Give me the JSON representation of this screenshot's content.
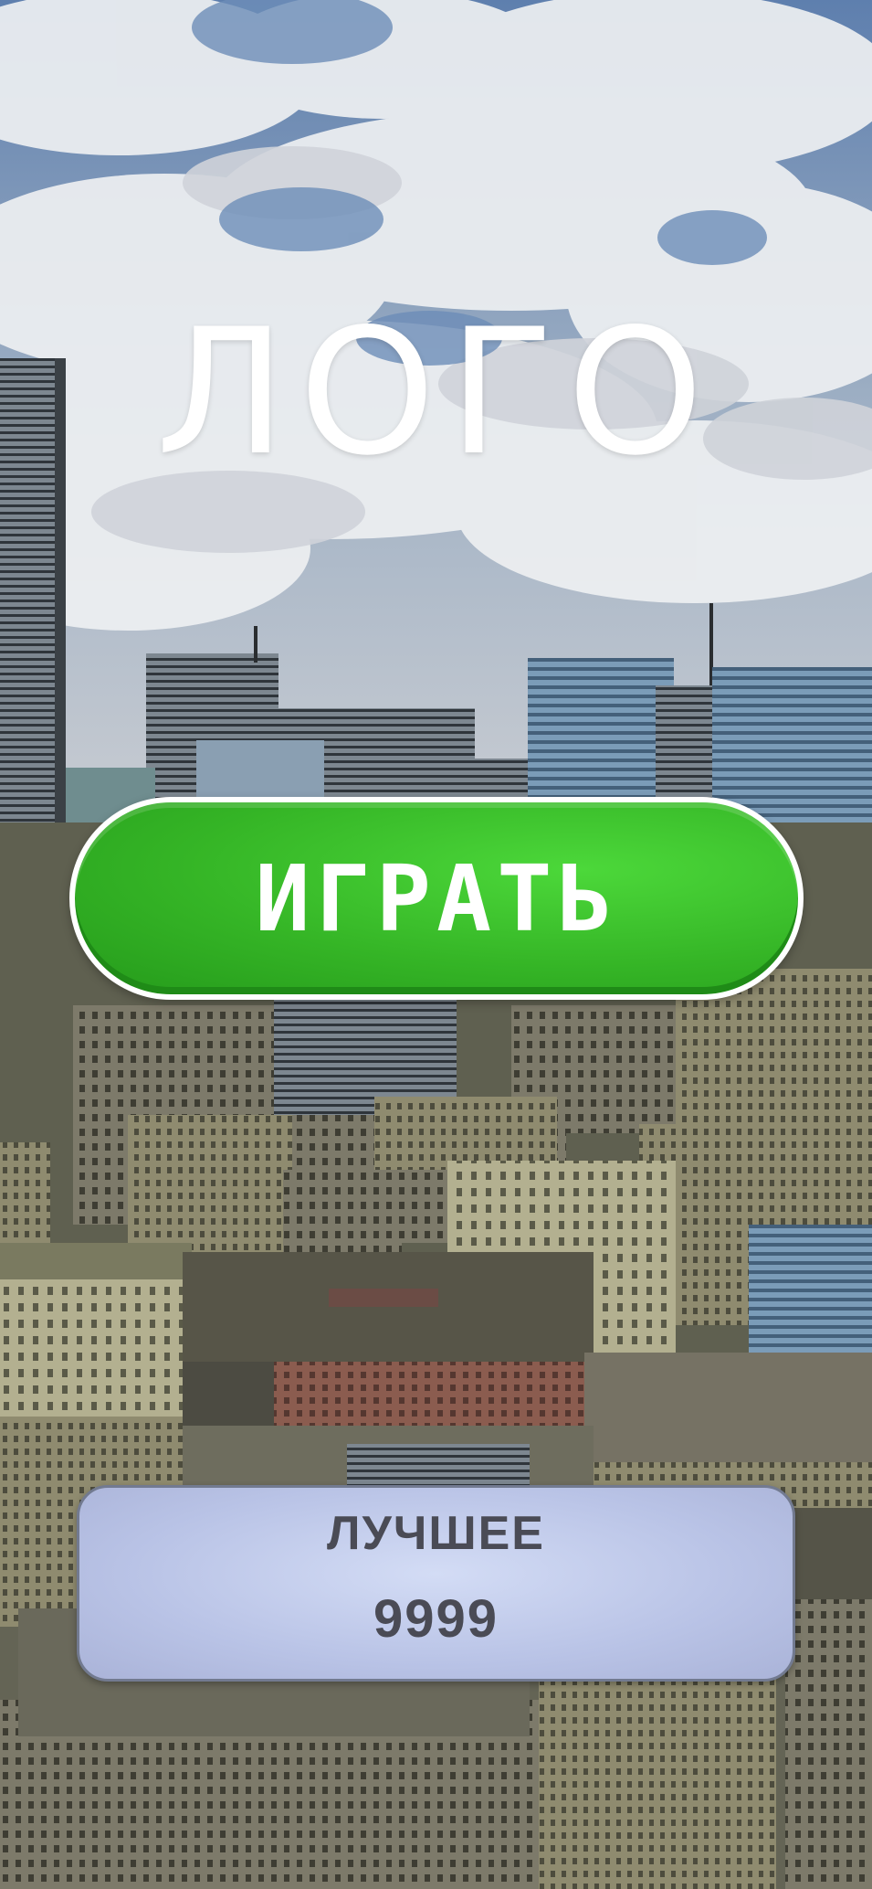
{
  "logo": {
    "text": "ЛОГО"
  },
  "play_button": {
    "label": "ИГРАТЬ"
  },
  "best": {
    "label": "ЛУЧШЕЕ",
    "value": "9999"
  },
  "colors": {
    "play_button": "#35b526",
    "best_panel": "#b9c3e6",
    "best_text": "#4a4b55",
    "logo_text": "#ffffff"
  }
}
